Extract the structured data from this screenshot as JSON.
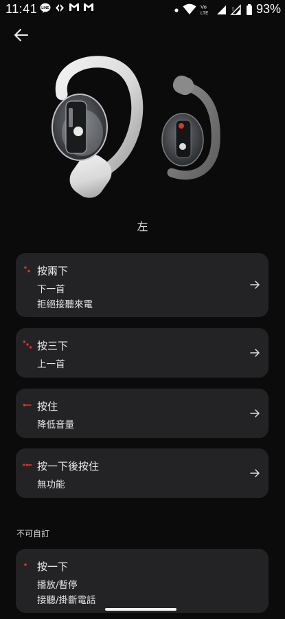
{
  "status_bar": {
    "time": "11:41",
    "notifications": [
      "line-icon",
      "carrefour-icon",
      "gmail-icon",
      "gmail-icon"
    ],
    "network_label": "LTE",
    "battery_percent": "93%"
  },
  "header": {
    "back_icon": "arrow-left-icon"
  },
  "side": {
    "title": "左"
  },
  "gestures": [
    {
      "icon": "double-dot-icon",
      "label": "按兩下",
      "lines": [
        "下一首",
        "拒絕接聽來電"
      ]
    },
    {
      "icon": "triple-dot-icon",
      "label": "按三下",
      "lines": [
        "上一首"
      ]
    },
    {
      "icon": "long-press-icon",
      "label": "按住",
      "lines": [
        "降低音量"
      ]
    },
    {
      "icon": "tap-hold-icon",
      "label": "按一下後按住",
      "lines": [
        "無功能"
      ]
    }
  ],
  "non_custom": {
    "header": "不可自訂",
    "items": [
      {
        "icon": "single-dot-icon",
        "label": "按一下",
        "lines": [
          "播放/暫停",
          "接聽/掛斷電話"
        ]
      }
    ]
  },
  "colors": {
    "background": "#0b0b0c",
    "card": "#232325",
    "accent_red": "#d9362b"
  }
}
